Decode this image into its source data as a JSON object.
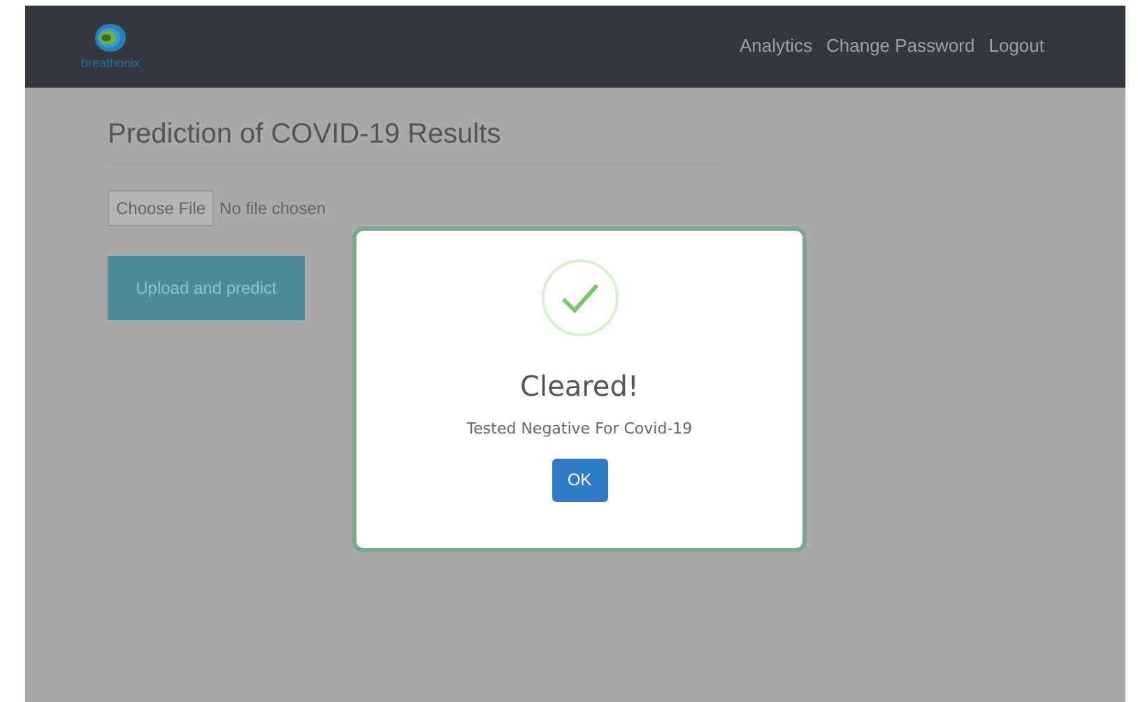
{
  "navbar": {
    "logo_text": "breathonix",
    "links": [
      "Analytics",
      "Change Password",
      "Logout"
    ]
  },
  "page": {
    "title": "Prediction of COVID-19 Results",
    "file_input": {
      "button": "Choose File",
      "status": "No file chosen"
    },
    "upload_button": "Upload and predict"
  },
  "dialog": {
    "title": "Cleared!",
    "message": "Tested Negative For Covid-19",
    "ok_button": "OK"
  }
}
